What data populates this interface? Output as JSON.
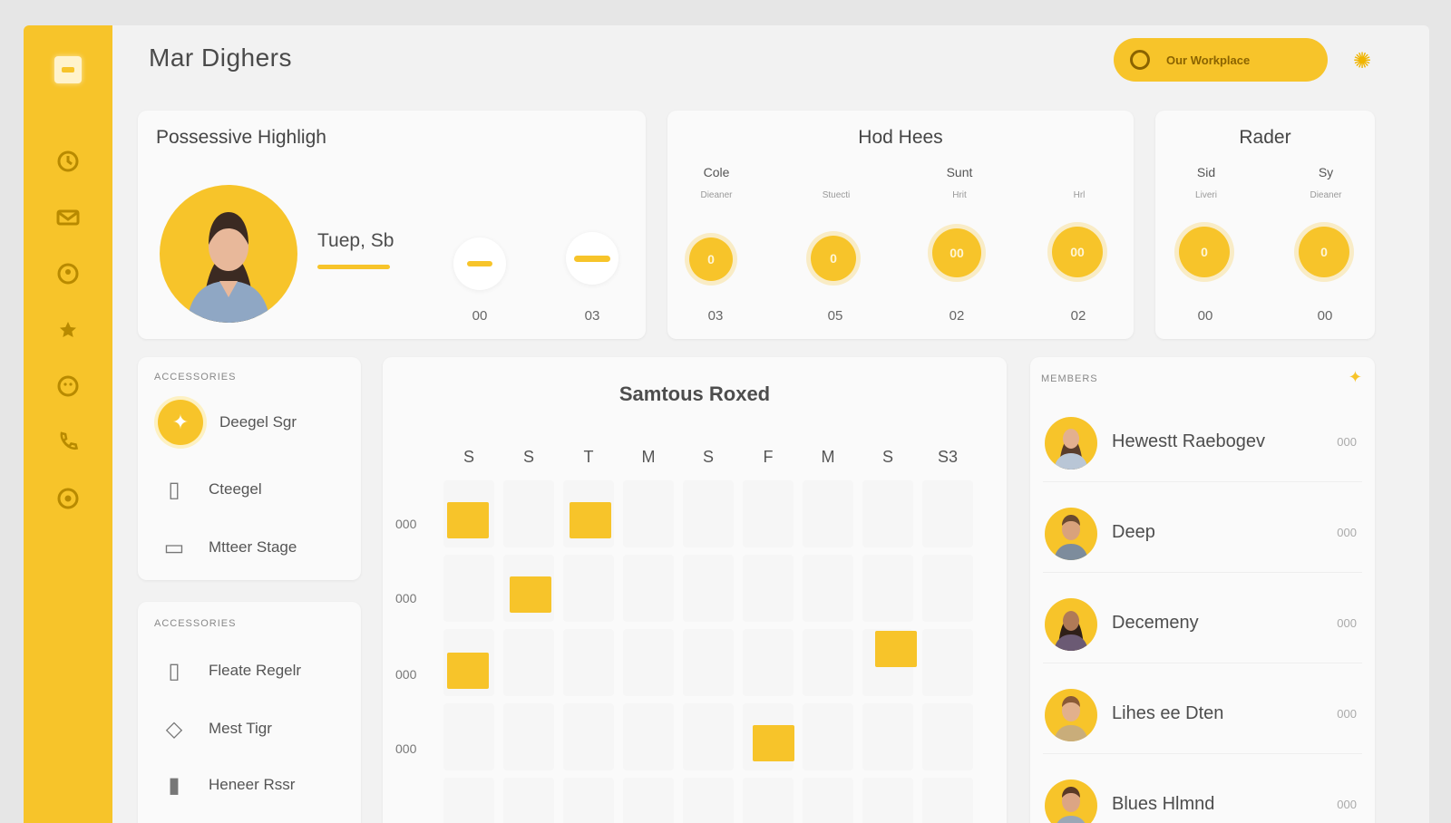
{
  "app": {
    "title": "Mar Dighers"
  },
  "header": {
    "cta_label": "Our Workplace"
  },
  "profile_card": {
    "title": "Possessive Highligh",
    "name": "Tuep, Sb",
    "stats": [
      {
        "label": "00"
      },
      {
        "label": "03"
      }
    ]
  },
  "hood_card": {
    "title": "Hod Hees",
    "columns": [
      {
        "head": "Cole",
        "sub": "Dieaner",
        "value": "0",
        "label": "03"
      },
      {
        "head": "",
        "sub": "Stuecti",
        "value": "0",
        "label": "05"
      },
      {
        "head": "Sunt",
        "sub": "Hrit",
        "value": "00",
        "label": "02"
      },
      {
        "head": "",
        "sub": "Hrl",
        "value": "00",
        "label": "02"
      }
    ]
  },
  "rader_card": {
    "title": "Rader",
    "columns": [
      {
        "head": "Sid",
        "sub": "Liveri",
        "value": "0",
        "label": "00"
      },
      {
        "head": "Sy",
        "sub": "Dieaner",
        "value": "0",
        "label": "00"
      }
    ]
  },
  "accessories_card": {
    "caption": "ACCESSORIES",
    "items": [
      {
        "label": "Deegel Sgr"
      },
      {
        "label": "Cteegel"
      },
      {
        "label": "Mtteer Stage"
      }
    ]
  },
  "accessories_card_2": {
    "caption": "ACCESSORIES",
    "items": [
      {
        "label": "Fleate Regelr"
      },
      {
        "label": "Mest Tigr"
      },
      {
        "label": "Heneer Rssr"
      }
    ]
  },
  "schedule": {
    "title": "Samtous Roxed",
    "days": [
      "S",
      "S",
      "T",
      "M",
      "S",
      "F",
      "M",
      "S",
      "S3"
    ],
    "rows": [
      "000",
      "000",
      "000",
      "000"
    ]
  },
  "members": {
    "caption": "MEMBERS",
    "items": [
      {
        "name": "Hewestt Raebogev",
        "meta": "000"
      },
      {
        "name": "Deep",
        "meta": "000"
      },
      {
        "name": "Decemeny",
        "meta": "000"
      },
      {
        "name": "Lihes ee Dten",
        "meta": "000"
      },
      {
        "name": "Blues Hlmnd",
        "meta": "000"
      }
    ]
  }
}
